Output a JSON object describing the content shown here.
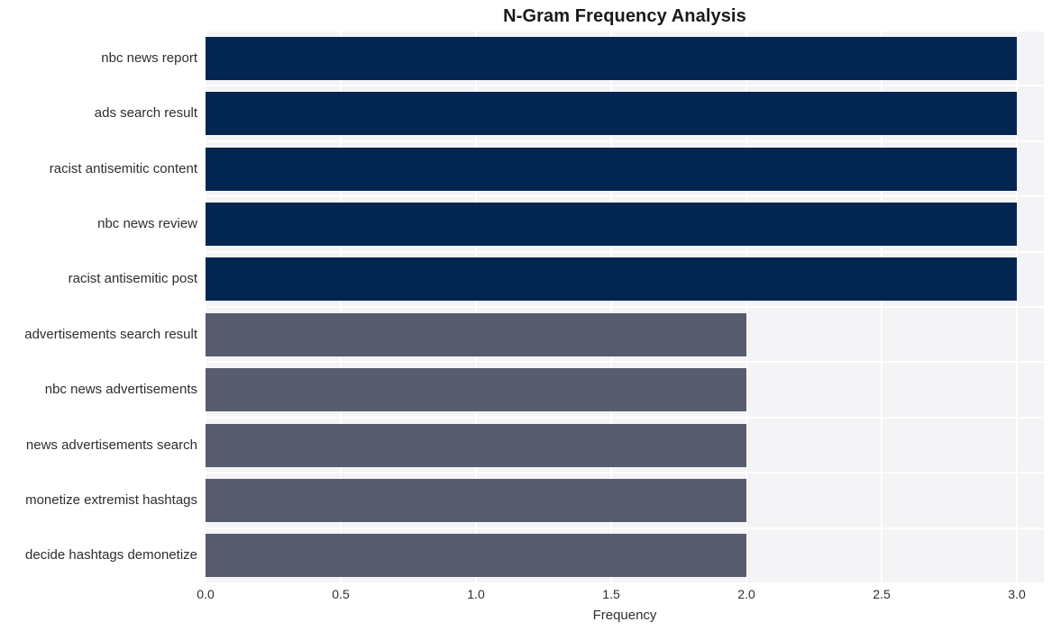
{
  "chart_data": {
    "type": "bar",
    "orientation": "horizontal",
    "title": "N-Gram Frequency Analysis",
    "xlabel": "Frequency",
    "ylabel": "",
    "xlim": [
      0.0,
      3.1
    ],
    "xticks": [
      "0.0",
      "0.5",
      "1.0",
      "1.5",
      "2.0",
      "2.5",
      "3.0"
    ],
    "xtick_values": [
      0.0,
      0.5,
      1.0,
      1.5,
      2.0,
      2.5,
      3.0
    ],
    "grid": true,
    "legend": "none",
    "categories": [
      "nbc news report",
      "ads search result",
      "racist antisemitic content",
      "nbc news review",
      "racist antisemitic post",
      "advertisements search result",
      "nbc news advertisements",
      "news advertisements search",
      "monetize extremist hashtags",
      "decide hashtags demonetize"
    ],
    "values": [
      3,
      3,
      3,
      3,
      3,
      2,
      2,
      2,
      2,
      2
    ],
    "bar_colors": [
      "#02264f",
      "#02264f",
      "#02264f",
      "#02264f",
      "#02264f",
      "#575d6e",
      "#575d6e",
      "#575d6e",
      "#575d6e",
      "#575d6e"
    ]
  },
  "style": {
    "plot_background": "#f4f4f6",
    "figure_background": "#ffffff",
    "gridline_color": "#ffffff",
    "text_color": "#2e2e2e",
    "title_color": "#1a1a1a",
    "color_high": "#02264f",
    "color_low": "#575d6e"
  }
}
